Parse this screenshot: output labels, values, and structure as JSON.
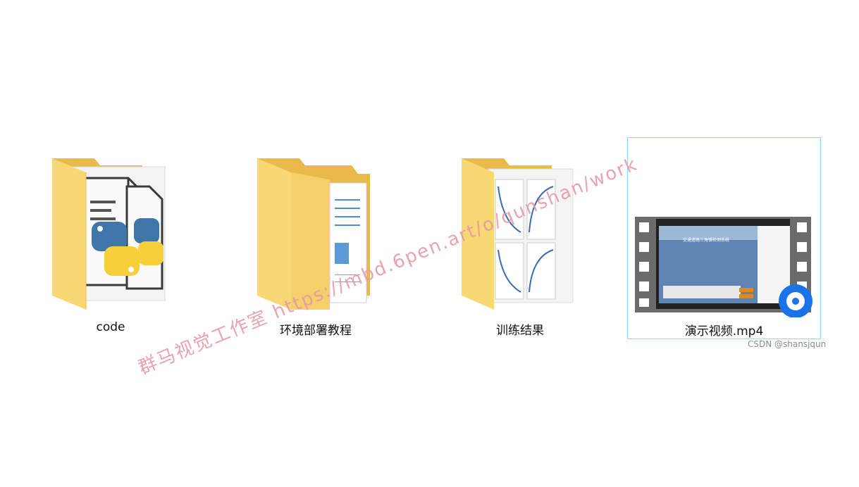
{
  "items": [
    {
      "name": "code",
      "kind": "folder-icon"
    },
    {
      "name": "环境部署教程",
      "kind": "folder-icon"
    },
    {
      "name": "训练结果",
      "kind": "folder-icon"
    },
    {
      "name": "演示视频.mp4",
      "kind": "video-file-icon"
    }
  ],
  "video_thumb": {
    "title": "交通道路三角锥检测系统"
  },
  "watermark": "群马视觉工作室 https://mbd.6pen.art/o/qunshan/work",
  "credit": "CSDN @shansjqun",
  "colors": {
    "folder": "#f8d775",
    "selection": "#99d1ff",
    "watermark": "#e79aa7",
    "player": "#1a73e8"
  }
}
